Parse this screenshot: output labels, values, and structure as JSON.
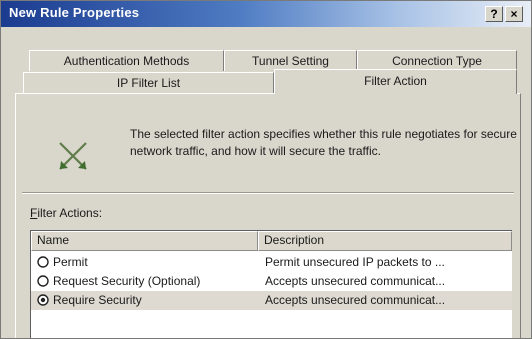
{
  "window": {
    "title": "New Rule Properties",
    "help_glyph": "?",
    "close_glyph": "×"
  },
  "tabs": {
    "back_row": [
      "Authentication Methods",
      "Tunnel Setting",
      "Connection Type"
    ],
    "front_row": [
      "IP Filter List",
      "Filter Action"
    ],
    "active": "Filter Action"
  },
  "panel": {
    "icon": "filter-action-x-icon",
    "description": "The selected filter action specifies whether this rule negotiates for secure network traffic, and how it will secure the traffic.",
    "filter_actions_label_mnemonic": "F",
    "filter_actions_label_rest": "ilter Actions:",
    "columns": [
      "Name",
      "Description"
    ],
    "rows": [
      {
        "name": "Permit",
        "description": "Permit unsecured IP packets to ...",
        "selected": false
      },
      {
        "name": "Request Security (Optional)",
        "description": "Accepts unsecured communicat...",
        "selected": false
      },
      {
        "name": "Require Security",
        "description": "Accepts unsecured communicat...",
        "selected": true
      }
    ]
  },
  "colors": {
    "titlebar_start": "#1b3b8f",
    "titlebar_end": "#e9eef6",
    "dialog_face": "#d9d6cc",
    "icon_green": "#5a8a3a"
  }
}
